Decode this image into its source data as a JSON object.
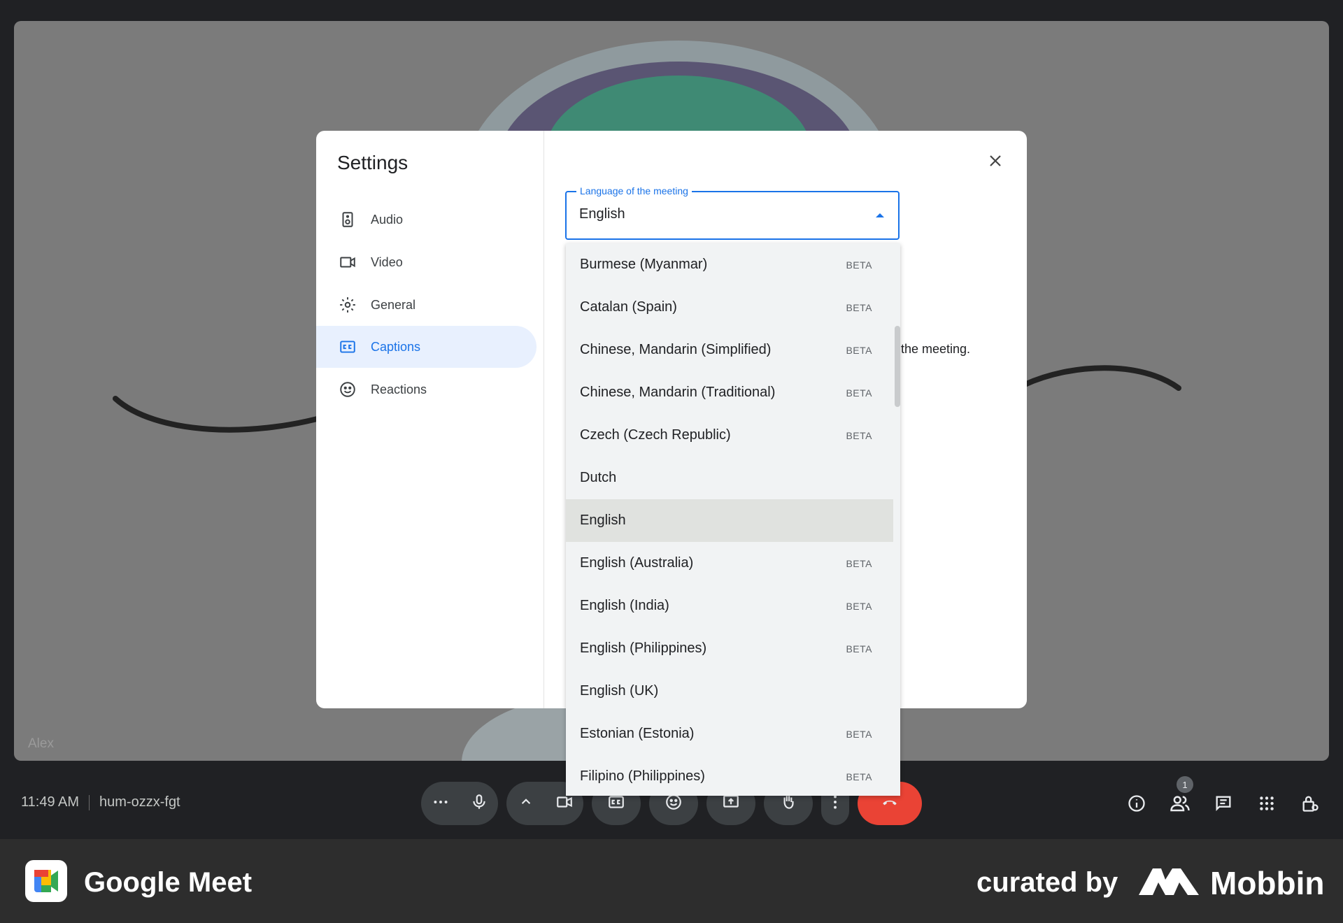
{
  "stage": {
    "participant_name": "Alex"
  },
  "callbar": {
    "time": "11:49 AM",
    "meeting_code": "hum-ozzx-fgt",
    "participants_count": "1"
  },
  "footer": {
    "app_name": "Google Meet",
    "curated_by": "curated by",
    "brand": "Mobbin"
  },
  "dialog": {
    "title": "Settings",
    "nav": [
      {
        "label": "Audio",
        "icon": "speaker-icon"
      },
      {
        "label": "Video",
        "icon": "video-camera-icon"
      },
      {
        "label": "General",
        "icon": "gear-icon"
      },
      {
        "label": "Captions",
        "icon": "captions-icon",
        "active": true
      },
      {
        "label": "Reactions",
        "icon": "smiley-icon"
      }
    ],
    "background_text": "the meeting.",
    "language_field": {
      "label": "Language of the meeting",
      "value": "English"
    },
    "options": [
      {
        "label": "Burmese (Myanmar)",
        "badge": "BETA"
      },
      {
        "label": "Catalan (Spain)",
        "badge": "BETA"
      },
      {
        "label": "Chinese, Mandarin (Simplified)",
        "badge": "BETA"
      },
      {
        "label": "Chinese, Mandarin (Traditional)",
        "badge": "BETA"
      },
      {
        "label": "Czech (Czech Republic)",
        "badge": "BETA"
      },
      {
        "label": "Dutch",
        "badge": ""
      },
      {
        "label": "English",
        "badge": "",
        "selected": true
      },
      {
        "label": "English (Australia)",
        "badge": "BETA"
      },
      {
        "label": "English (India)",
        "badge": "BETA"
      },
      {
        "label": "English (Philippines)",
        "badge": "BETA"
      },
      {
        "label": "English (UK)",
        "badge": ""
      },
      {
        "label": "Estonian (Estonia)",
        "badge": "BETA"
      },
      {
        "label": "Filipino (Philippines)",
        "badge": "BETA"
      }
    ]
  },
  "colors": {
    "accent": "#1a73e8",
    "end_call": "#ea4335",
    "dropdown_bg": "#f1f3f4",
    "selected_bg": "#e0e2df"
  }
}
